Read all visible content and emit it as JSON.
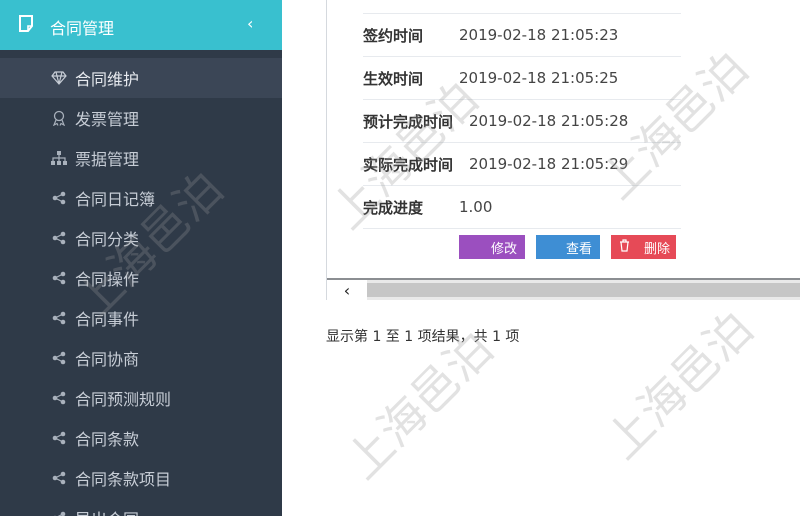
{
  "sidebar": {
    "header": {
      "label": "合同管理",
      "chevron": "‹"
    },
    "items": [
      {
        "label": "合同维护",
        "icon": "diamond-icon",
        "active": true
      },
      {
        "label": "发票管理",
        "icon": "award-icon"
      },
      {
        "label": "票据管理",
        "icon": "sitemap-icon"
      },
      {
        "label": "合同日记簿",
        "icon": "share-icon"
      },
      {
        "label": "合同分类",
        "icon": "share-icon"
      },
      {
        "label": "合同操作",
        "icon": "share-icon"
      },
      {
        "label": "合同事件",
        "icon": "share-icon"
      },
      {
        "label": "合同协商",
        "icon": "share-icon"
      },
      {
        "label": "合同预测规则",
        "icon": "share-icon"
      },
      {
        "label": "合同条款",
        "icon": "share-icon"
      },
      {
        "label": "合同条款项目",
        "icon": "share-icon"
      },
      {
        "label": "导出合同",
        "icon": "share-icon"
      }
    ]
  },
  "detail": {
    "rows": [
      {
        "key": "签约时间",
        "value": "2019-02-18 21:05:23"
      },
      {
        "key": "生效时间",
        "value": "2019-02-18 21:05:25"
      },
      {
        "key": "预计完成时间",
        "value": "2019-02-18 21:05:28"
      },
      {
        "key": "实际完成时间",
        "value": "2019-02-18 21:05:29"
      },
      {
        "key": "完成进度",
        "value": "1.00"
      }
    ]
  },
  "actions": {
    "edit": "修改",
    "view": "查看",
    "delete": "删除"
  },
  "scroll": {
    "left_arrow": "‹"
  },
  "pager": {
    "info": "显示第 1 至 1 项结果，共 1 项"
  },
  "watermark": "上海邑泊",
  "colors": {
    "sidebar_bg": "#2f3a48",
    "header_bg": "#39c0cf",
    "edit": "#9b4fbf",
    "view": "#3e8ed4",
    "delete": "#e64a57"
  }
}
